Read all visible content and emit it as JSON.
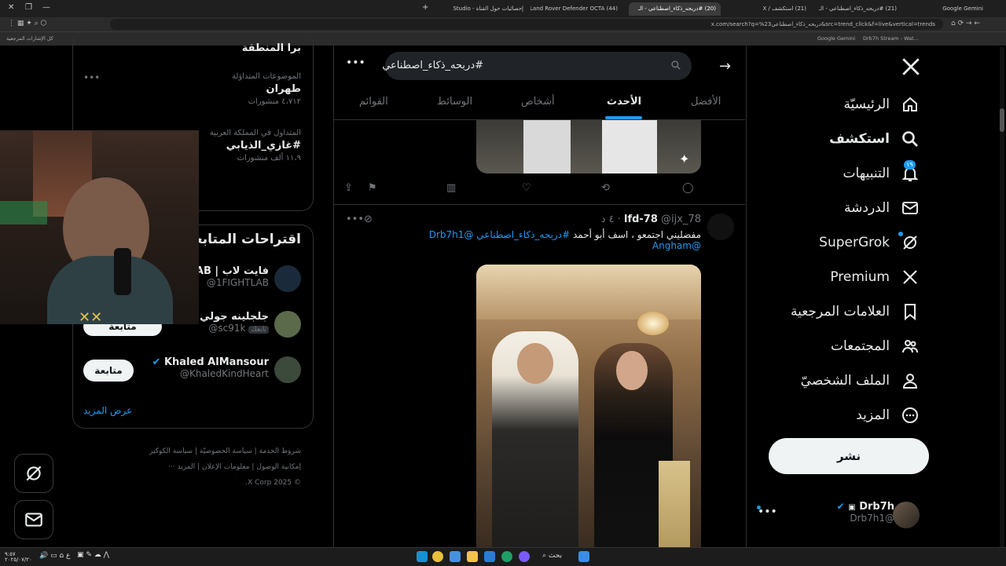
{
  "browser": {
    "tabs": [
      {
        "title": "Google Gemini",
        "active": false
      },
      {
        "title": "(21) #دربحه_ذكاء_اصطناعي - الـ",
        "active": false
      },
      {
        "title": "(21) استكشف / X",
        "active": false
      },
      {
        "title": "(20) #دربحه_ذكاء_اصطناعي - الـ",
        "active": true
      },
      {
        "title": "(44) Land Rover Defender OCTA",
        "active": false
      },
      {
        "title": "إحصائيات حول القناة - Studio",
        "active": false
      }
    ],
    "url": "x.com/search?q=%23دربحه_ذكاء_اصطناعي&src=trend_click&f=live&vertical=trends",
    "bookmarks": [
      "كل الإشارات المرجعية",
      "Google Gemini",
      "Drb7h Stream - Wat..."
    ]
  },
  "sidebar": {
    "items": [
      {
        "label": "الرئيسيّة",
        "icon": "home-icon"
      },
      {
        "label": "استكشف",
        "icon": "search-icon"
      },
      {
        "label": "التنبيهات",
        "icon": "bell-icon",
        "badge": "١٩"
      },
      {
        "label": "الدردشة",
        "icon": "mail-icon"
      },
      {
        "label": "SuperGrok",
        "icon": "grok-icon"
      },
      {
        "label": "Premium",
        "icon": "x-logo-icon"
      },
      {
        "label": "العلامات المرجعية",
        "icon": "bookmark-icon"
      },
      {
        "label": "المجتمعات",
        "icon": "communities-icon"
      },
      {
        "label": "الملف الشخصيّ",
        "icon": "profile-icon"
      },
      {
        "label": "المزيد",
        "icon": "more-circle-icon"
      }
    ],
    "post_label": "نشر",
    "account": {
      "name": "Drb7h",
      "handle": "@Drb7h1"
    }
  },
  "search": {
    "query": "#دربحه_ذكاء_اصطناعي"
  },
  "tabs": [
    "الأفضل",
    "الأحدث",
    "أشخاص",
    "الوسائط",
    "القوائم"
  ],
  "tweet": {
    "name": "lfd-78",
    "handle": "@ijx_78",
    "time": "٤ د",
    "text_plain": "مفضليني اجتمعو ، اسف أبو أحمد",
    "hashtag": "#دربحه_ذكاء_اصطناعي",
    "mention1": "@Drb7h1",
    "mention2": "@Angham"
  },
  "right": {
    "trend_region_partial": "برا المنطقة",
    "trends": [
      {
        "category": "الموضوعات المتداوَلة",
        "name": "طهران",
        "count": "٤،٧١٢ منشورات"
      },
      {
        "category": "المتداول في المملكة العربية",
        "name": "#غازي_الذيابي",
        "count": "١١،٩ ألف منشورات"
      }
    ],
    "who_to_follow_title": "اقتراحات المتابعة",
    "suggestions": [
      {
        "name": "فايت لاب | AB",
        "handle": "@1FIGHTLAB",
        "follows_you": ""
      },
      {
        "name": "جلجلينه جولي",
        "handle": "@sc91k",
        "follows_you": "تابعك"
      },
      {
        "name": "Khaled AlMansour",
        "handle": "@KhaledKindHeart",
        "follows_you": ""
      }
    ],
    "follow_label": "متابعة",
    "show_more": "عرض المزيد",
    "footer_links": [
      "شروط الخدمة",
      "سياسة الخصوصيّة",
      "سياسة الكوكيز",
      "إمكانية الوصول",
      "معلومات الإعلان",
      "المزيد ···"
    ],
    "copyright": "© 2025 X Corp."
  },
  "taskbar": {
    "search_label": "بحث",
    "lang": "ع",
    "time": "٩:٥٧",
    "date": "٢٠٢٥/٠٧/٢٠"
  }
}
